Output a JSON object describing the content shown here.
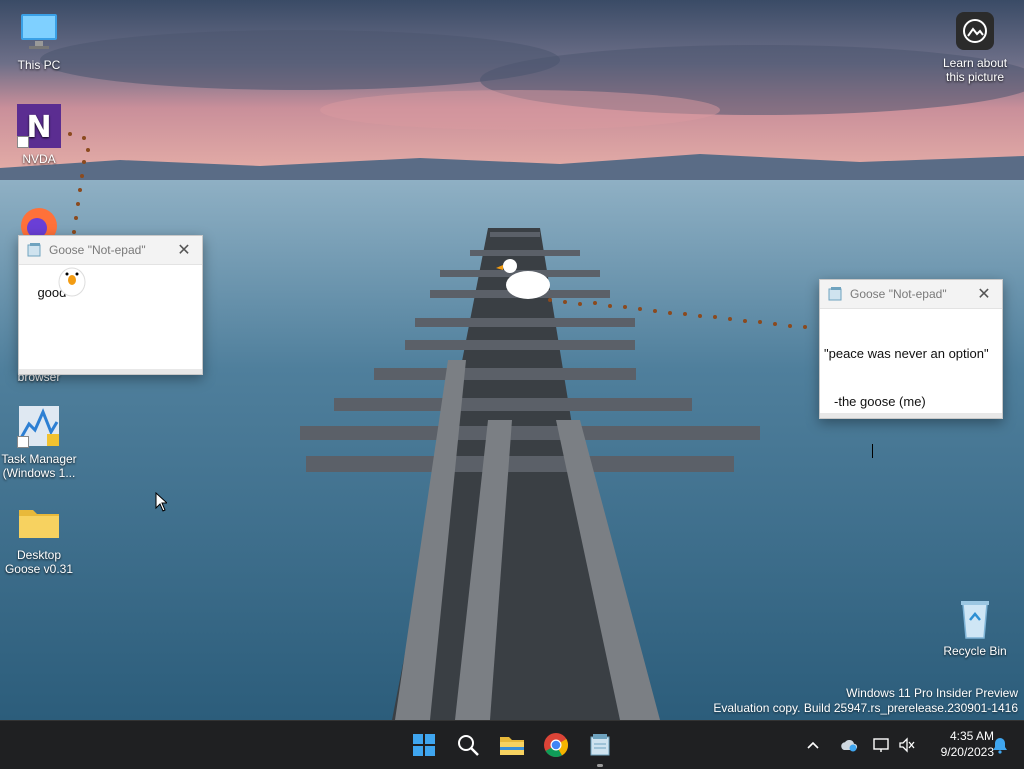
{
  "desktop": {
    "icons": [
      {
        "label": "This PC",
        "icon": "monitor-icon"
      },
      {
        "label": "NVDA",
        "icon": "nvda-icon"
      },
      {
        "label": "browser",
        "icon": "browser-icon"
      },
      {
        "label": "Task Manager (Windows 1...",
        "icon": "task-manager-icon"
      },
      {
        "label": "Desktop Goose v0.31",
        "icon": "folder-icon"
      },
      {
        "label": "Recycle Bin",
        "icon": "recycle-bin-icon"
      }
    ],
    "learn_about": {
      "label": "Learn about this picture",
      "icon": "learn-about-icon"
    }
  },
  "notepad_small": {
    "title": "Goose \"Not-epad\"",
    "text": "good"
  },
  "notepad_large": {
    "title": "Goose \"Not-epad\"",
    "line1": "\"peace was never an option\"",
    "line2": "-the goose (me)"
  },
  "watermark": {
    "line1": "Windows 11 Pro Insider Preview",
    "line2": "Evaluation copy. Build 25947.rs_prerelease.230901-1416"
  },
  "taskbar": {
    "items": [
      "windows-start-icon",
      "search-icon",
      "file-explorer-icon",
      "chrome-icon",
      "notepad-icon"
    ],
    "tray": [
      "chevron-up-icon",
      "onedrive-icon",
      "network-icon",
      "volume-muted-icon",
      "notification-bell-icon"
    ]
  },
  "clock": {
    "time": "4:35 AM",
    "date": "9/20/2023"
  },
  "colors": {
    "accent": "#0078d4",
    "taskbar": "#1f2022",
    "goose_trail": "#8b4a1e"
  }
}
